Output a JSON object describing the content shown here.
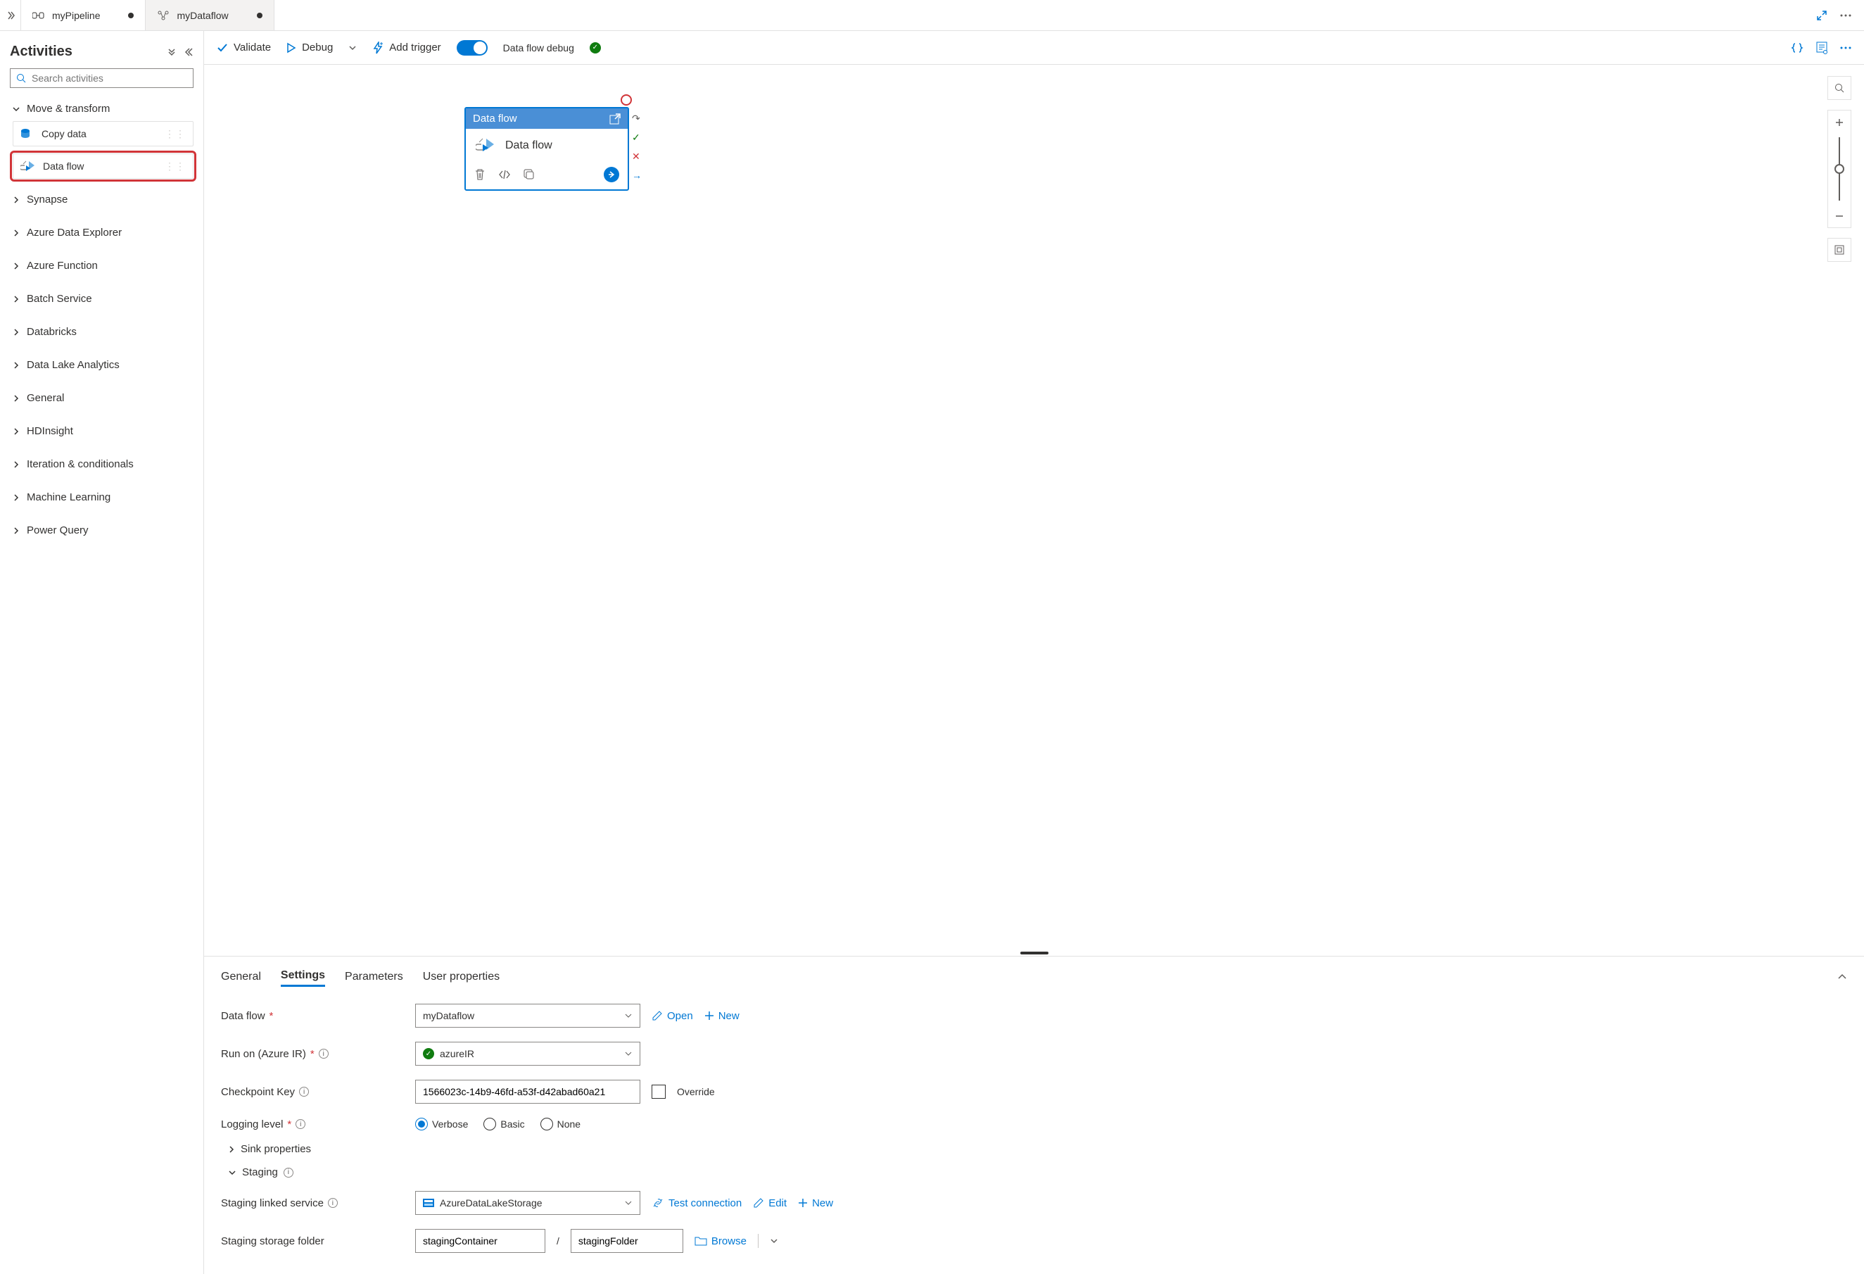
{
  "tabs": [
    {
      "name": "myPipeline",
      "dirty": true
    },
    {
      "name": "myDataflow",
      "dirty": true
    }
  ],
  "sidebar": {
    "title": "Activities",
    "search_placeholder": "Search activities",
    "move_transform": "Move & transform",
    "copy_data": "Copy data",
    "data_flow": "Data flow",
    "categories": [
      "Synapse",
      "Azure Data Explorer",
      "Azure Function",
      "Batch Service",
      "Databricks",
      "Data Lake Analytics",
      "General",
      "HDInsight",
      "Iteration & conditionals",
      "Machine Learning",
      "Power Query"
    ]
  },
  "toolbar": {
    "validate": "Validate",
    "debug": "Debug",
    "add_trigger": "Add trigger",
    "dataflow_debug": "Data flow debug"
  },
  "node": {
    "header": "Data flow",
    "title": "Data flow"
  },
  "props": {
    "tabs": {
      "general": "General",
      "settings": "Settings",
      "parameters": "Parameters",
      "user_props": "User properties"
    },
    "data_flow_label": "Data flow",
    "data_flow_value": "myDataflow",
    "open": "Open",
    "new": "New",
    "run_on_label": "Run on (Azure IR)",
    "run_on_value": "azureIR",
    "checkpoint_label": "Checkpoint Key",
    "checkpoint_value": "1566023c-14b9-46fd-a53f-d42abad60a21",
    "override": "Override",
    "logging_label": "Logging level",
    "log_verbose": "Verbose",
    "log_basic": "Basic",
    "log_none": "None",
    "sink_props": "Sink properties",
    "staging": "Staging",
    "staging_ls_label": "Staging linked service",
    "staging_ls_value": "AzureDataLakeStorage",
    "test_conn": "Test connection",
    "edit": "Edit",
    "staging_folder_label": "Staging storage folder",
    "staging_container": "stagingContainer",
    "staging_folder": "stagingFolder",
    "browse": "Browse"
  }
}
